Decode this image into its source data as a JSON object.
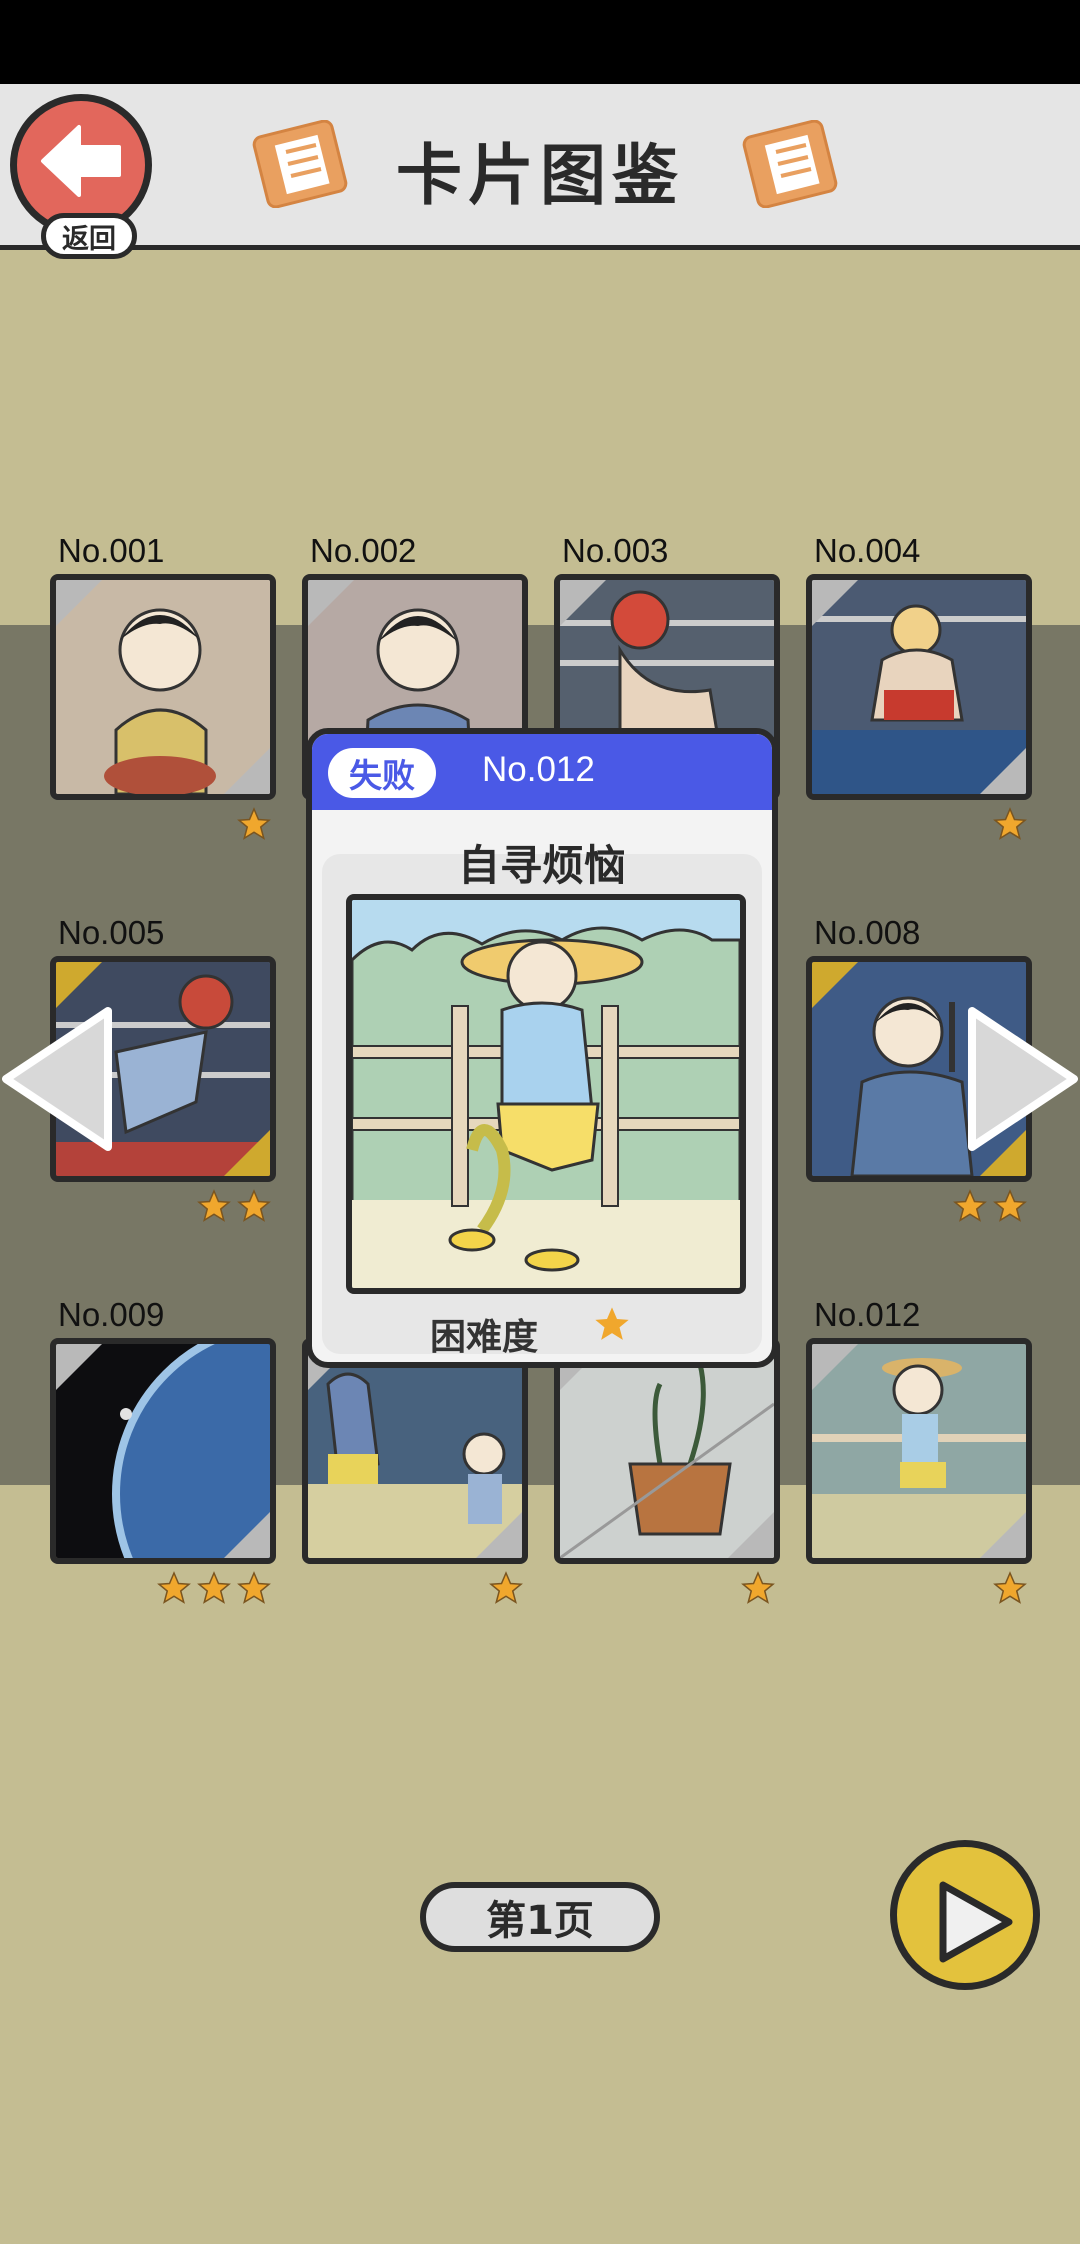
{
  "header": {
    "back_label": "返回",
    "title": "卡片图鉴"
  },
  "colors": {
    "background": "#c4bd92",
    "back_button": "#e2675c",
    "next_button": "#e3c23d",
    "overlay_header": "#4a59e6",
    "star": "#f0a72d",
    "gold_corner": "#cfa92e"
  },
  "cards": [
    {
      "number": "No.001",
      "stars": 1,
      "frame": "silver"
    },
    {
      "number": "No.002",
      "stars": 0,
      "frame": "silver"
    },
    {
      "number": "No.003",
      "stars": 0,
      "frame": "silver"
    },
    {
      "number": "No.004",
      "stars": 1,
      "frame": "silver"
    },
    {
      "number": "No.005",
      "stars": 2,
      "frame": "gold"
    },
    {
      "number": "",
      "stars": 0,
      "frame": "silver"
    },
    {
      "number": "",
      "stars": 0,
      "frame": "silver"
    },
    {
      "number": "No.008",
      "stars": 2,
      "frame": "gold"
    },
    {
      "number": "No.009",
      "stars": 3,
      "frame": "silver"
    },
    {
      "number": "",
      "stars": 1,
      "frame": "silver"
    },
    {
      "number": "",
      "stars": 1,
      "frame": "silver"
    },
    {
      "number": "No.012",
      "stars": 1,
      "frame": "silver"
    }
  ],
  "popup": {
    "status": "失败",
    "number": "No.012",
    "name": "自寻烦恼",
    "difficulty_label": "困难度",
    "difficulty_stars": 1
  },
  "footer": {
    "page_label": "第1页"
  },
  "icons": {
    "back": "left-arrow-icon",
    "prev": "left-triangle-icon",
    "next_card": "right-triangle-icon",
    "next_page": "play-icon"
  }
}
